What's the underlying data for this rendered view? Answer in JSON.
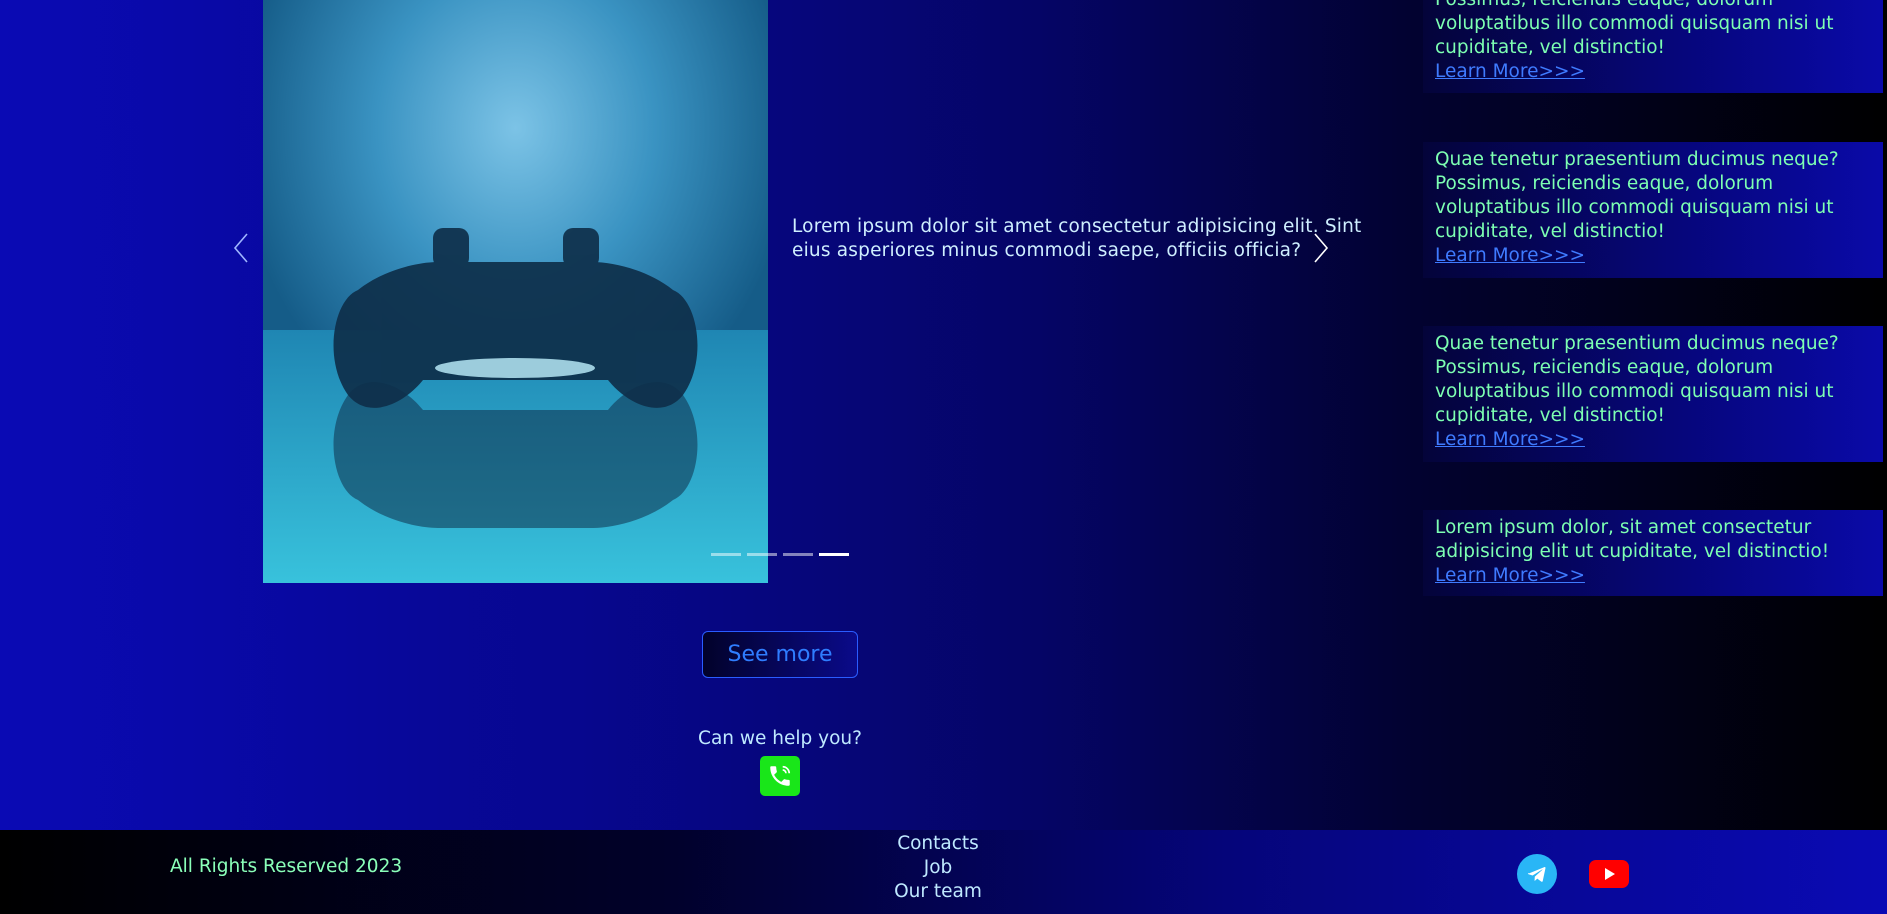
{
  "carousel": {
    "slide_text": "Lorem ipsum dolor sit amet consectetur adipisicing elit. Sint eius asperiores minus commodi saepe, officiis officia?",
    "image_icon": "gamepad-image",
    "prev_icon": "chevron-left-icon",
    "next_icon": "chevron-right-icon",
    "indicators": [
      {
        "active": false
      },
      {
        "active": false
      },
      {
        "active": false
      },
      {
        "active": true
      }
    ],
    "active_index": 4,
    "slide_count": 4
  },
  "news": [
    {
      "text": "Quae tenetur praesentium ducimus neque? Possimus, reiciendis eaque, dolorum voluptatibus illo commodi quisquam nisi ut cupiditate, vel distinctio!",
      "link": "Learn More>>>"
    },
    {
      "text": "Quae tenetur praesentium ducimus neque? Possimus, reiciendis eaque, dolorum voluptatibus illo commodi quisquam nisi ut cupiditate, vel distinctio!",
      "link": "Learn More>>>"
    },
    {
      "text": "Quae tenetur praesentium ducimus neque? Possimus, reiciendis eaque, dolorum voluptatibus illo commodi quisquam nisi ut cupiditate, vel distinctio!",
      "link": "Learn More>>>"
    },
    {
      "text": "Lorem ipsum dolor, sit amet consectetur adipisicing elit ut cupiditate, vel distinctio!",
      "link": "Learn More>>>"
    }
  ],
  "see_more_label": "See more",
  "help": {
    "text": "Can we help you?",
    "icon": "phone-icon"
  },
  "footer": {
    "copyright": "All Rights Reserved 2023",
    "links": [
      "Contacts",
      "Job",
      "Our team"
    ],
    "social": [
      "telegram-icon",
      "youtube-icon"
    ]
  },
  "colors": {
    "accent_green": "#7dffb2",
    "link_blue": "#3f7bff",
    "phone_green": "#19e619",
    "telegram": "#29b6f6",
    "youtube": "#ff0000"
  }
}
